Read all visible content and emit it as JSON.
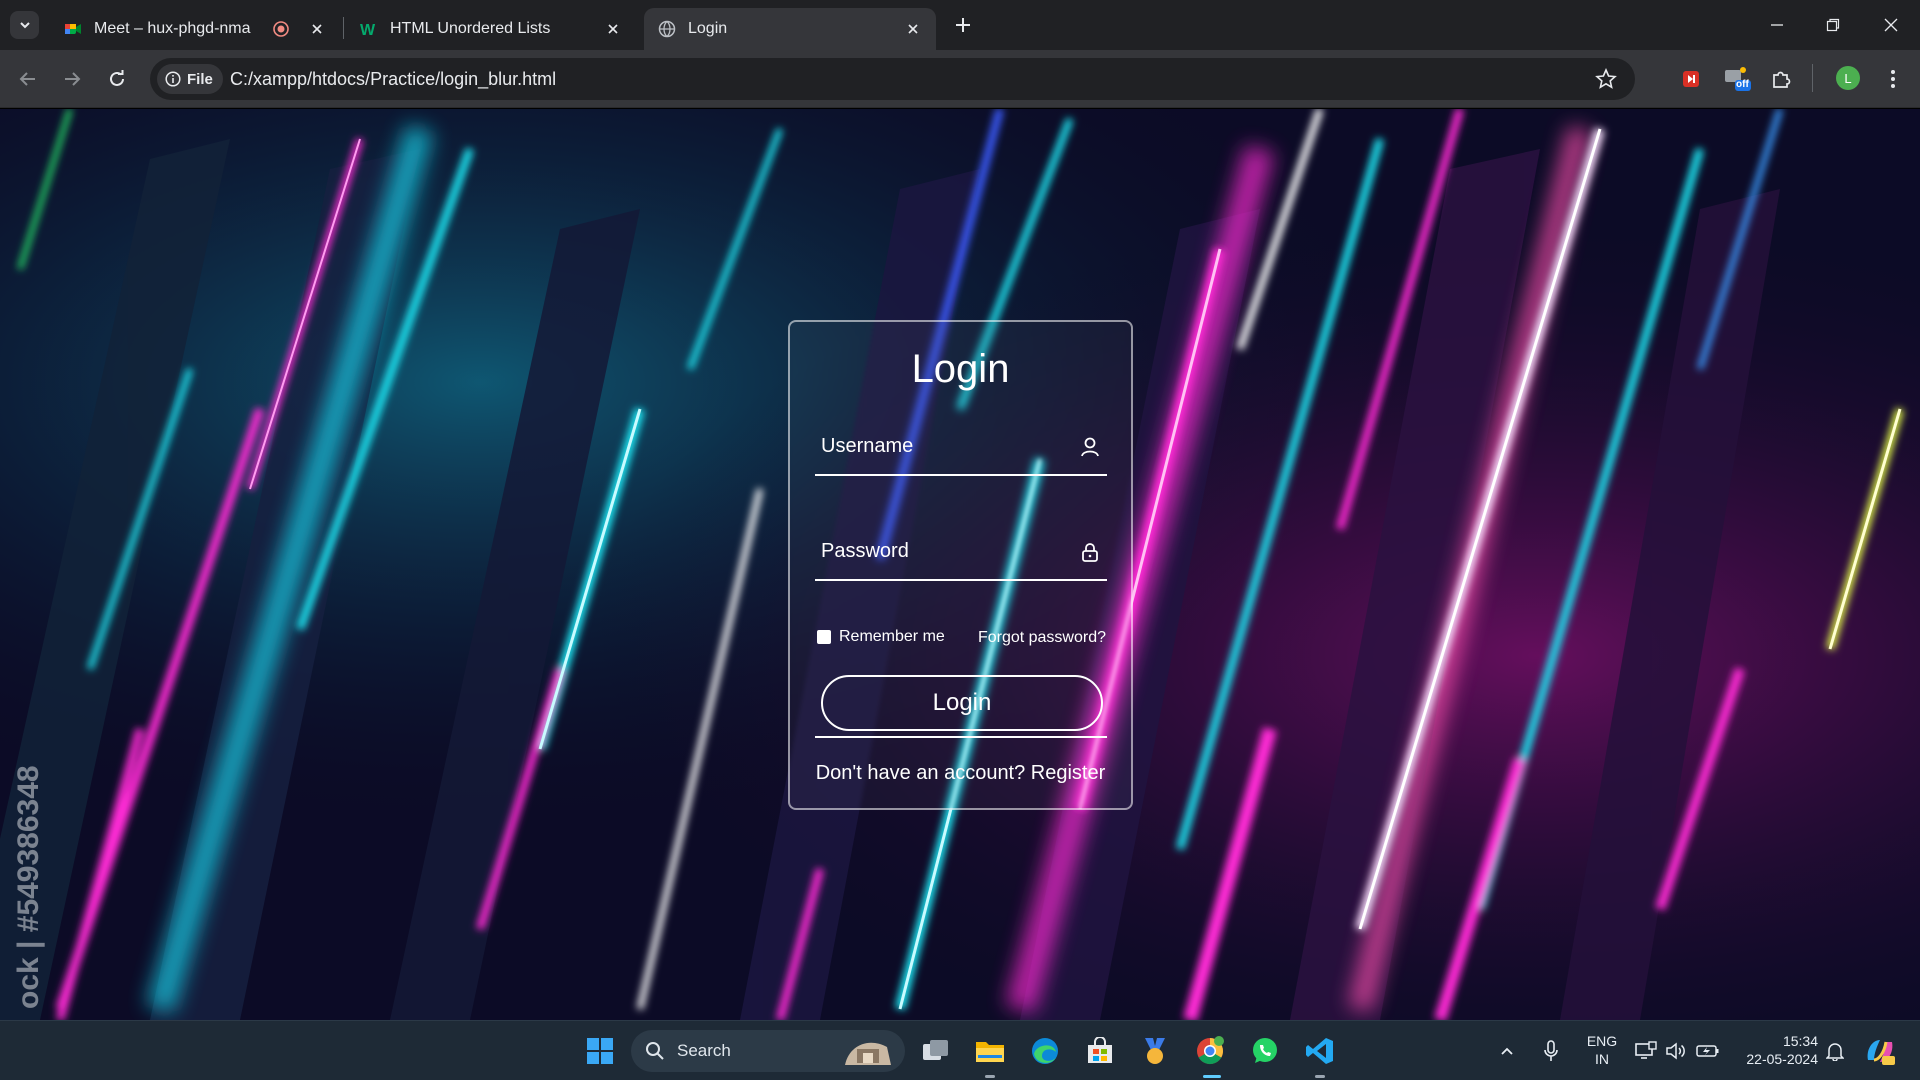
{
  "browser": {
    "tabs": [
      {
        "title": "Meet – hux-phgd-nma",
        "favicon": "google-meet-icon",
        "recording": true
      },
      {
        "title": "HTML Unordered Lists",
        "favicon": "w3schools-icon"
      },
      {
        "title": "Login",
        "favicon": "globe-icon",
        "active": true
      }
    ],
    "address": {
      "chip_label": "File",
      "url": "C:/xampp/htdocs/Practice/login_blur.html"
    },
    "profile_initial": "L",
    "extension_badge": "off"
  },
  "page": {
    "watermark": "ock | #549386348",
    "login": {
      "title": "Login",
      "username_placeholder": "Username",
      "password_placeholder": "Password",
      "remember_label": "Remember me",
      "forgot_label": "Forgot password?",
      "button_label": "Login",
      "register_text": "Don't have an account? Register"
    }
  },
  "taskbar": {
    "search_label": "Search",
    "language": {
      "line1": "ENG",
      "line2": "IN"
    },
    "clock": {
      "time": "15:34",
      "date": "22-05-2024"
    },
    "pinned": [
      "start-icon",
      "search",
      "task-view-icon",
      "file-explorer-icon",
      "edge-icon",
      "store-icon",
      "app-icon",
      "chrome-icon",
      "whatsapp-icon",
      "vscode-icon"
    ]
  },
  "colors": {
    "chrome_dark": "#202124",
    "chrome_toolbar": "#35363a",
    "taskbar": "#1e2a36",
    "neon_pink": "#ff2bd6",
    "neon_cyan": "#1de9f6",
    "neon_blue": "#3b5bff"
  }
}
